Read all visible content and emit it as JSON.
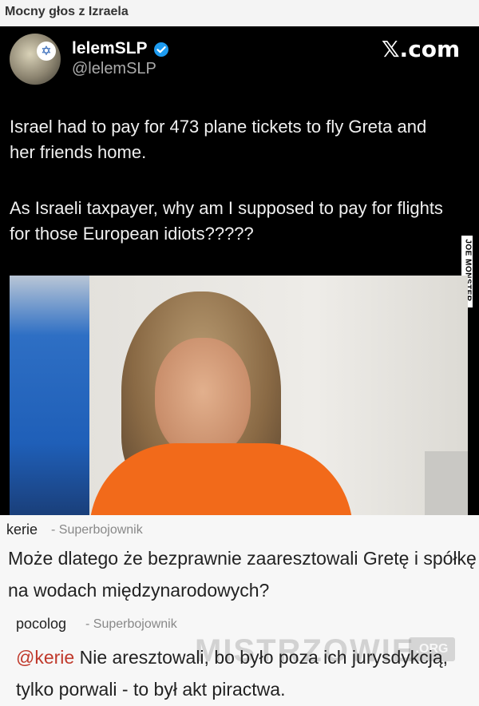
{
  "page": {
    "title": "Mocny głos z Izraela"
  },
  "tweet": {
    "display_name": "lelemSLP",
    "handle": "@lelemSLP",
    "source": "𝕏.com",
    "paragraph_1": "Israel had to pay for 473 plane tickets to fly Greta and her friends home.",
    "paragraph_2": "As Israeli taxpayer, why am I supposed to pay for flights for those European idiots?????",
    "photo_watermark": "JOE MONSTER",
    "verified_color": "#1d9bf0"
  },
  "comments": [
    {
      "author": "kerie",
      "rank": "- Superbojownik",
      "text": "Może dlatego że bezprawnie zaaresztowali Gretę i spółkę na wodach międzynarodowych?"
    },
    {
      "author": "pocolog",
      "rank": "- Superbojownik",
      "mention": "@kerie",
      "text": " Nie aresztowali, bo było poza ich jurysdykcją, tylko porwali - to był akt piractwa."
    }
  ],
  "site_watermark": {
    "name": "MISTRZOWIE",
    "tld": ".ORG"
  },
  "colors": {
    "mention": "#c0392b",
    "tweet_background": "#000000",
    "shirt": "#f26a1a"
  }
}
